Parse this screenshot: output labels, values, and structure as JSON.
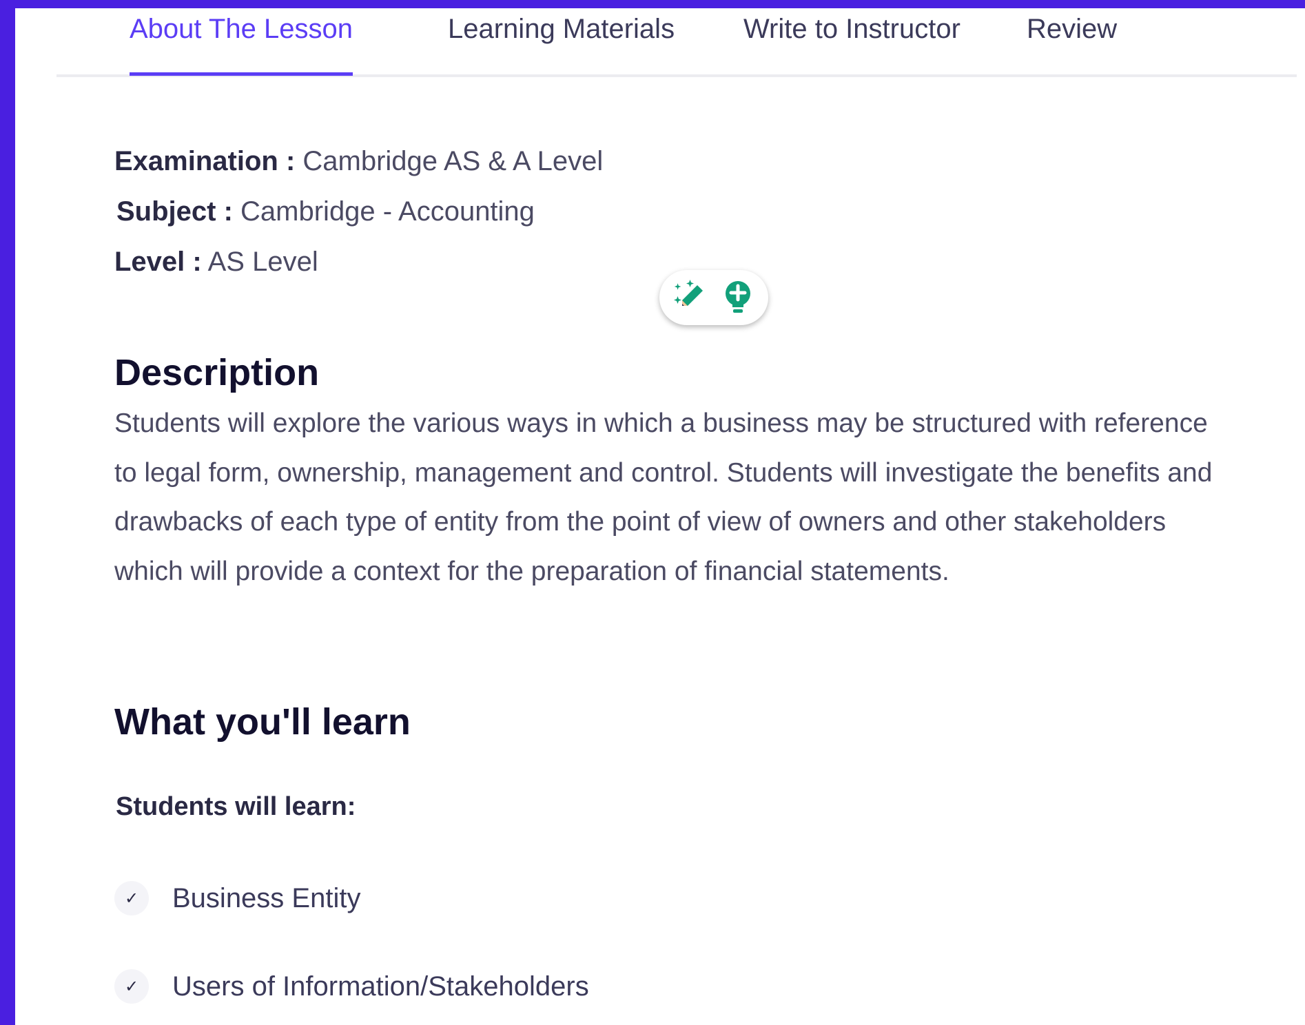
{
  "tabs": [
    {
      "label": "About The Lesson",
      "active": true
    },
    {
      "label": "Learning Materials",
      "active": false
    },
    {
      "label": "Write to Instructor",
      "active": false
    },
    {
      "label": "Review",
      "active": false
    }
  ],
  "meta": {
    "examination": {
      "key": "Examination :",
      "value": "Cambridge AS & A Level"
    },
    "subject": {
      "key": "Subject :",
      "value": "Cambridge - Accounting"
    },
    "level": {
      "key": "Level :",
      "value": "AS Level"
    }
  },
  "description": {
    "heading": "Description",
    "text": "Students will explore the various ways in which a business may be structured with reference to legal form, ownership, management and control. Students will investigate the benefits and drawbacks of each type of entity from the point of view of owners and other stakeholders which will provide a context for the preparation of financial statements."
  },
  "learn": {
    "heading": "What you'll learn",
    "lead": "Students will learn:",
    "items": [
      "Business Entity",
      "Users of Information/Stakeholders"
    ]
  },
  "colors": {
    "accent": "#5b3df5",
    "frame": "#4a1fe0",
    "toolbar_icon": "#12a07a"
  },
  "icons": {
    "toolbar": [
      "magic-pencil-icon",
      "lightbulb-icon"
    ],
    "check": "check-icon"
  }
}
